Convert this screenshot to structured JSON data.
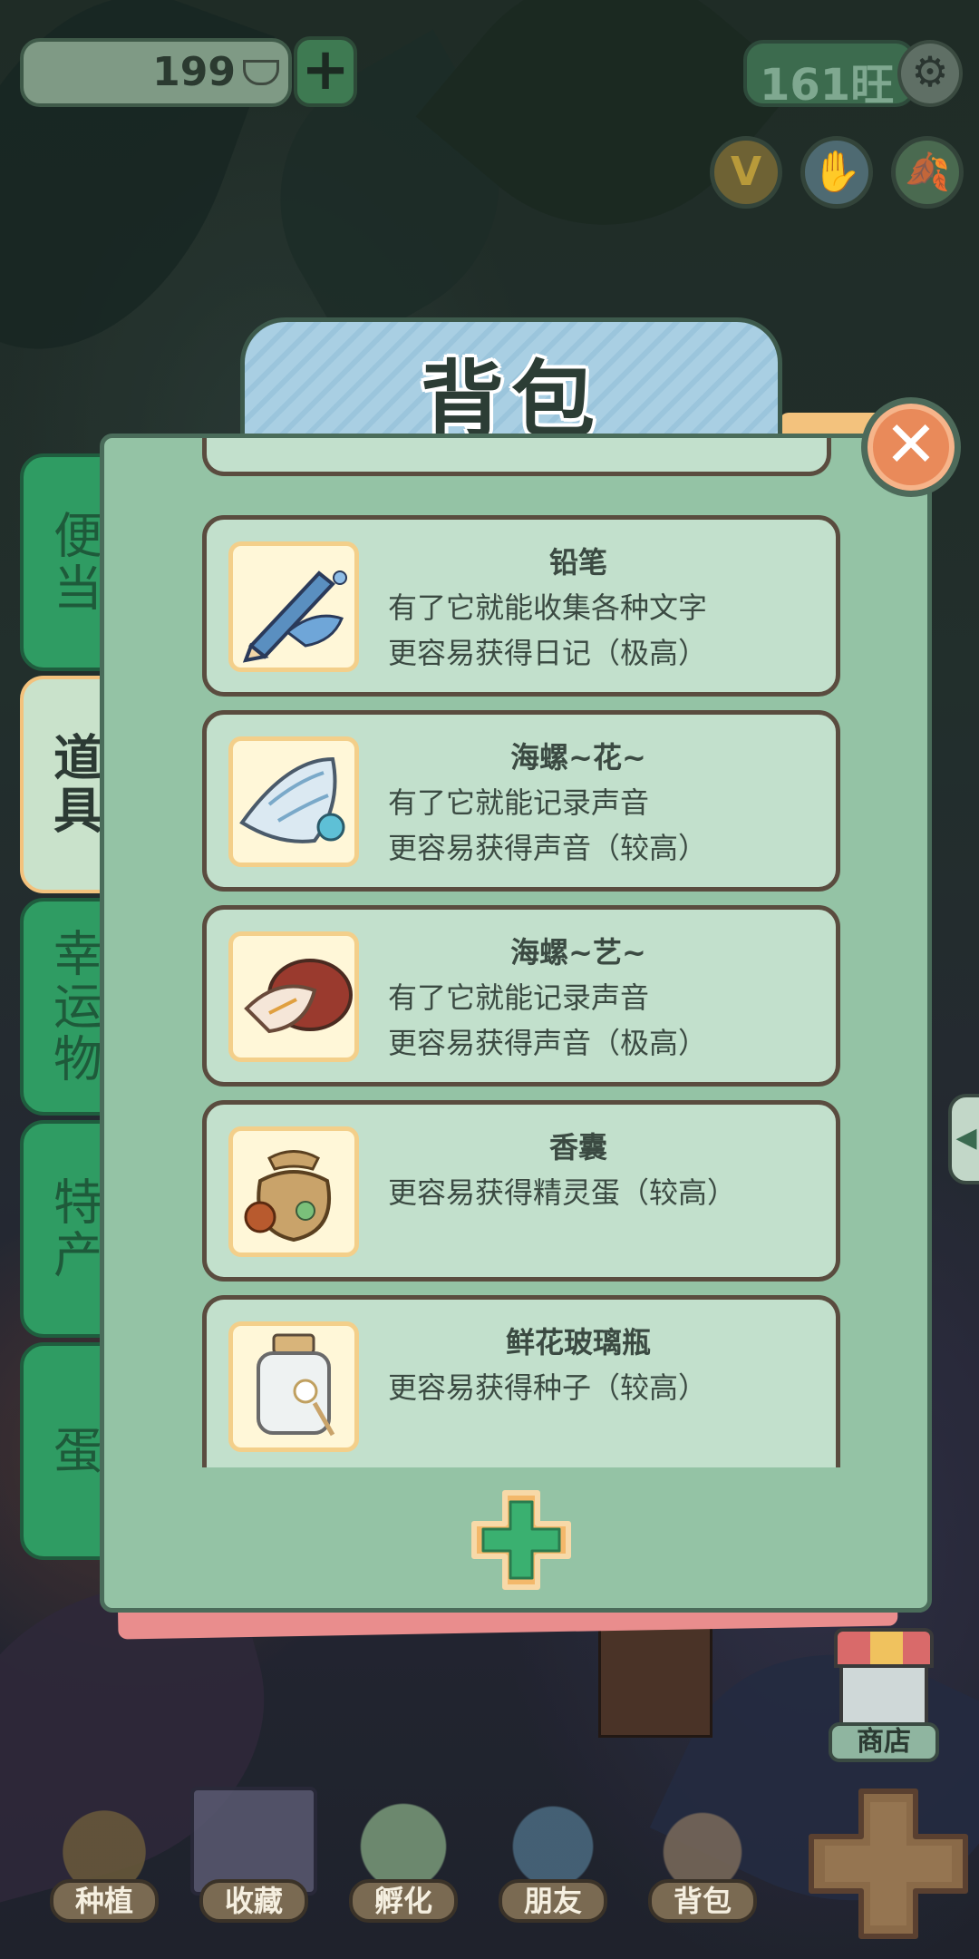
{
  "top_bar": {
    "coins": "199",
    "add_label": "+",
    "wang": "161旺",
    "settings_glyph": "⚙",
    "v_button": "V",
    "hand_glyph": "✋",
    "leaf_glyph": "🍂"
  },
  "panel": {
    "title": "背包",
    "close_glyph": "✕",
    "tabs": [
      {
        "label": "便当"
      },
      {
        "label": "道具"
      },
      {
        "label": "幸运物"
      },
      {
        "label": "特产"
      },
      {
        "label": "蛋"
      }
    ],
    "active_tab": "道具",
    "items": [
      {
        "name": "铅笔",
        "lines": [
          "有了它就能收集各种文字",
          "更容易获得日记（极高）"
        ]
      },
      {
        "name": "海螺~花~",
        "lines": [
          "有了它就能记录声音",
          "更容易获得声音（较高）"
        ]
      },
      {
        "name": "海螺~艺~",
        "lines": [
          "有了它就能记录声音",
          "更容易获得声音（极高）"
        ]
      },
      {
        "name": "香囊",
        "lines": [
          "更容易获得精灵蛋（较高）"
        ]
      },
      {
        "name": "鲜花玻璃瓶",
        "lines": [
          "更容易获得种子（较高）"
        ]
      }
    ]
  },
  "side_arrow": "◀",
  "shop": {
    "label": "商店"
  },
  "bottom_nav": [
    {
      "label": "种植"
    },
    {
      "label": "收藏"
    },
    {
      "label": "孵化"
    },
    {
      "label": "朋友"
    },
    {
      "label": "背包"
    }
  ],
  "colors": {
    "tab_green": "#2f9c63",
    "panel_green": "#94c3a5",
    "card": "#c2e0cc",
    "close_orange": "#e98a5a"
  }
}
